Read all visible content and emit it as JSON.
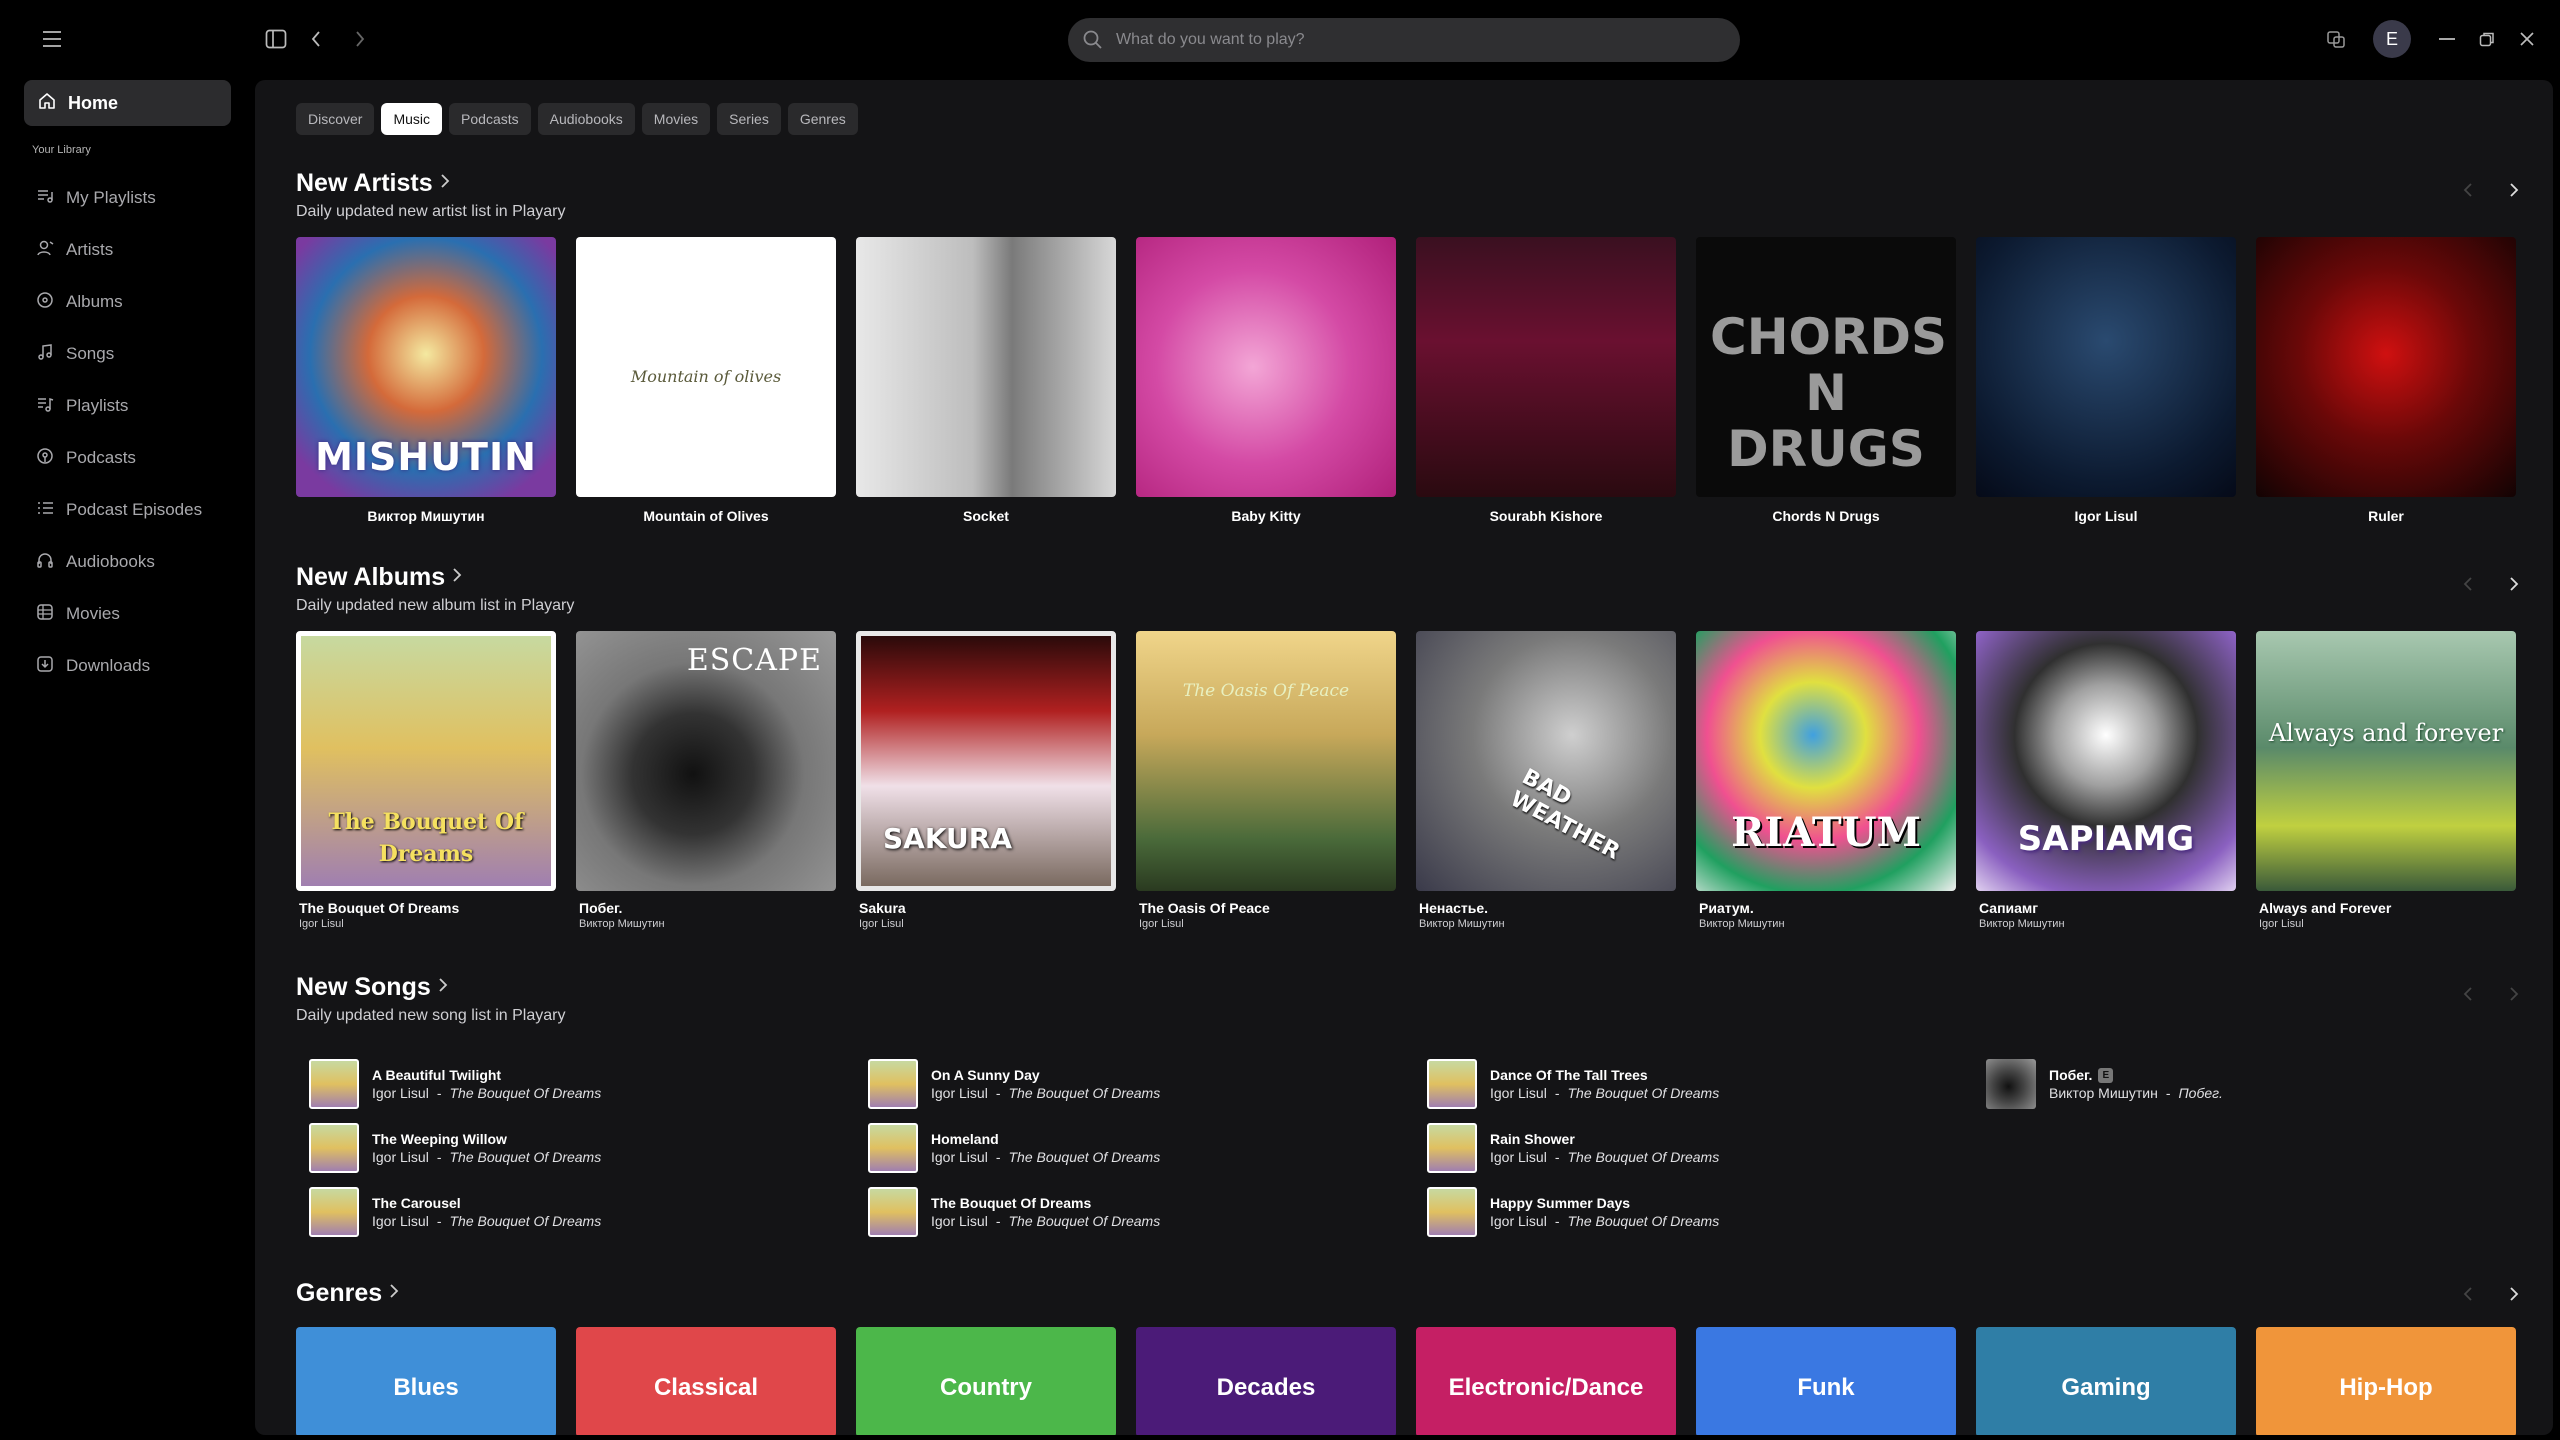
{
  "search": {
    "placeholder": "What do you want to play?"
  },
  "user": {
    "initial": "E"
  },
  "sidebar": {
    "home_label": "Home",
    "library_label": "Your Library",
    "items": [
      {
        "label": "My Playlists",
        "icon": "playlist-icon"
      },
      {
        "label": "Artists",
        "icon": "artist-icon"
      },
      {
        "label": "Albums",
        "icon": "album-icon"
      },
      {
        "label": "Songs",
        "icon": "music-note-icon"
      },
      {
        "label": "Playlists",
        "icon": "music-list-icon"
      },
      {
        "label": "Podcasts",
        "icon": "podcast-icon"
      },
      {
        "label": "Podcast Episodes",
        "icon": "episodes-icon"
      },
      {
        "label": "Audiobooks",
        "icon": "headphones-icon"
      },
      {
        "label": "Movies",
        "icon": "film-icon"
      },
      {
        "label": "Downloads",
        "icon": "download-icon"
      }
    ]
  },
  "tabs": [
    "Discover",
    "Music",
    "Podcasts",
    "Audiobooks",
    "Movies",
    "Series",
    "Genres"
  ],
  "active_tab": "Music",
  "new_artists": {
    "title": "New Artists",
    "subtitle": "Daily updated new artist list in Playary",
    "items": [
      {
        "name": "Виктор Мишутин",
        "overlay": "MISHUTIN"
      },
      {
        "name": "Mountain of Olives",
        "overlay": "Mountain of olives"
      },
      {
        "name": "Socket",
        "overlay": ""
      },
      {
        "name": "Baby Kitty",
        "overlay": ""
      },
      {
        "name": "Sourabh Kishore",
        "overlay": ""
      },
      {
        "name": "Chords N Drugs",
        "overlay": "CHORDS N DRUGS"
      },
      {
        "name": "Igor Lisul",
        "overlay": ""
      },
      {
        "name": "Ruler",
        "overlay": ""
      }
    ]
  },
  "new_albums": {
    "title": "New Albums",
    "subtitle": "Daily updated new album list in Playary",
    "items": [
      {
        "title": "The Bouquet Of Dreams",
        "artist": "Igor Lisul",
        "overlay": "The Bouquet Of Dreams"
      },
      {
        "title": "Побег.",
        "artist": "Виктор Мишутин",
        "overlay": "ESCAPE"
      },
      {
        "title": "Sakura",
        "artist": "Igor Lisul",
        "overlay": "SAKURA"
      },
      {
        "title": "The Oasis Of Peace",
        "artist": "Igor Lisul",
        "overlay": "The Oasis Of Peace"
      },
      {
        "title": "Ненастье.",
        "artist": "Виктор Мишутин",
        "overlay": "BAD WEATHER"
      },
      {
        "title": "Риатум.",
        "artist": "Виктор Мишутин",
        "overlay": "RIATUM"
      },
      {
        "title": "Сапиамг",
        "artist": "Виктор Мишутин",
        "overlay": "SAPIAMG"
      },
      {
        "title": "Always and Forever",
        "artist": "Igor Lisul",
        "overlay": "Always and forever"
      }
    ]
  },
  "new_songs": {
    "title": "New Songs",
    "subtitle": "Daily updated new song list in Playary",
    "items": [
      {
        "title": "A Beautiful Twilight",
        "artist": "Igor Lisul",
        "album": "The Bouquet Of Dreams",
        "explicit": false
      },
      {
        "title": "On A Sunny Day",
        "artist": "Igor Lisul",
        "album": "The Bouquet Of Dreams",
        "explicit": false
      },
      {
        "title": "Dance Of The Tall Trees",
        "artist": "Igor Lisul",
        "album": "The Bouquet Of Dreams",
        "explicit": false
      },
      {
        "title": "Побег.",
        "artist": "Виктор Мишутин",
        "album": "Побег.",
        "explicit": true
      },
      {
        "title": "The Weeping Willow",
        "artist": "Igor Lisul",
        "album": "The Bouquet Of Dreams",
        "explicit": false
      },
      {
        "title": "Homeland",
        "artist": "Igor Lisul",
        "album": "The Bouquet Of Dreams",
        "explicit": false
      },
      {
        "title": "Rain Shower",
        "artist": "Igor Lisul",
        "album": "The Bouquet Of Dreams",
        "explicit": false
      },
      {
        "title": "The Carousel",
        "artist": "Igor Lisul",
        "album": "The Bouquet Of Dreams",
        "explicit": false
      },
      {
        "title": "The Bouquet Of Dreams",
        "artist": "Igor Lisul",
        "album": "The Bouquet Of Dreams",
        "explicit": false
      },
      {
        "title": "Happy Summer Days",
        "artist": "Igor Lisul",
        "album": "The Bouquet Of Dreams",
        "explicit": false
      }
    ],
    "explicit_badge": "E",
    "separator": "-"
  },
  "genres": {
    "title": "Genres",
    "items": [
      {
        "label": "Blues",
        "color": "#3f8fd8"
      },
      {
        "label": "Classical",
        "color": "#e0474a"
      },
      {
        "label": "Country",
        "color": "#4cb74a"
      },
      {
        "label": "Decades",
        "color": "#4b1b78"
      },
      {
        "label": "Electronic/Dance",
        "color": "#c51f64"
      },
      {
        "label": "Funk",
        "color": "#3a78e2"
      },
      {
        "label": "Gaming",
        "color": "#2f7ea6"
      },
      {
        "label": "Hip-Hop",
        "color": "#f0953a"
      }
    ]
  },
  "colors": {
    "background": "#000000",
    "panel": "#141416",
    "accent": "#ffffff"
  }
}
